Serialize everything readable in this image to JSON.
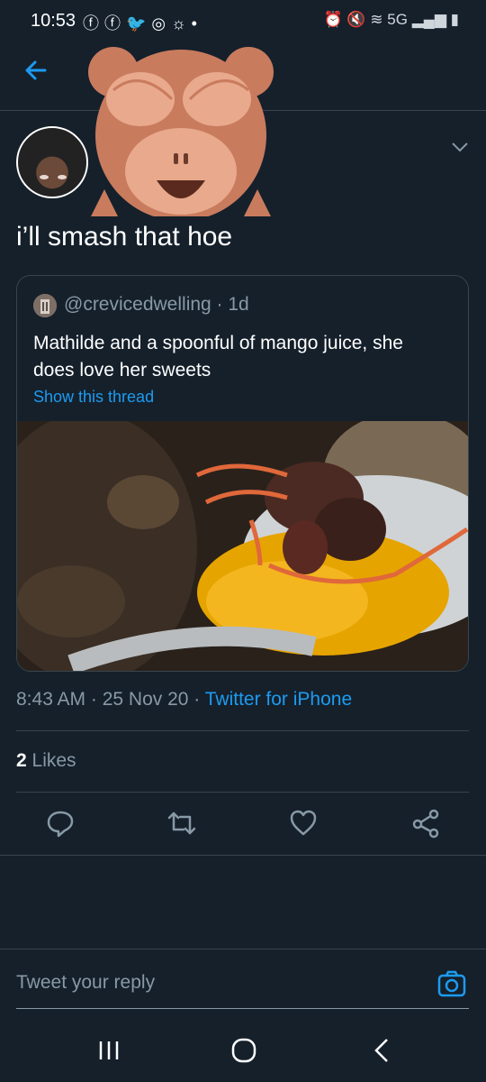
{
  "status_bar": {
    "time": "10:53",
    "left_icons": [
      "facebook-icon",
      "facebook-icon",
      "twitter-icon",
      "instagram-icon",
      "weather-icon",
      "dot-icon"
    ],
    "network": "5G"
  },
  "tweet": {
    "text": "i’ll smash that hoe",
    "timestamp": "8:43 AM · 25 Nov 20 · ",
    "source": "Twitter for iPhone",
    "likes_count": "2",
    "likes_label": "Likes"
  },
  "quoted_tweet": {
    "handle": "@crevicedwelling · 1d",
    "text": "Mathilde and a spoonful of mango juice, she does love her sweets",
    "thread_link": "Show this thread"
  },
  "reply": {
    "placeholder": "Tweet your reply"
  },
  "colors": {
    "background": "#15202b",
    "accent": "#1d9bf0",
    "muted": "#8899a6",
    "border": "#38444d"
  }
}
